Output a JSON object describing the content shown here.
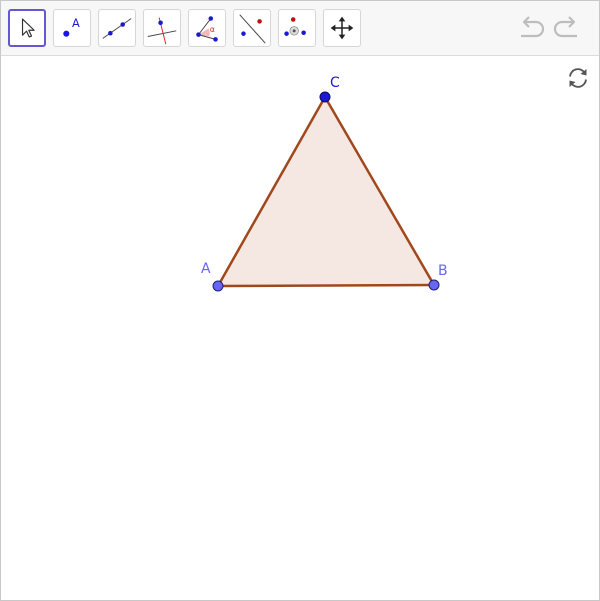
{
  "toolbar": {
    "tools": [
      {
        "name": "move-tool",
        "active": true
      },
      {
        "name": "point-tool",
        "glyph": "A"
      },
      {
        "name": "line-tool"
      },
      {
        "name": "perpendicular-line-tool"
      },
      {
        "name": "angle-tool",
        "glyph": "α"
      },
      {
        "name": "reflect-tool"
      },
      {
        "name": "special-points-tool"
      },
      {
        "name": "move-graphics-view-tool"
      }
    ]
  },
  "construction": {
    "points": [
      {
        "label": "A"
      },
      {
        "label": "B"
      },
      {
        "label": "C"
      }
    ]
  },
  "colors": {
    "accent": "#6557d2",
    "segment": "#a0481c",
    "polygon_fill": "#f5e8e3",
    "point_free": "#6666ee",
    "point_dark": "#1a1ad6"
  }
}
